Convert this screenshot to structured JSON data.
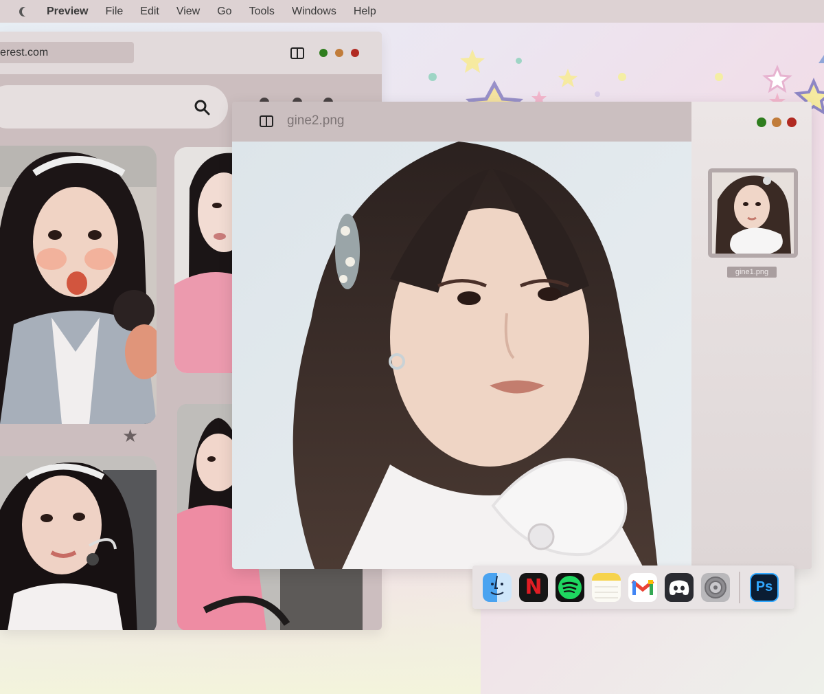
{
  "menubar": {
    "app_name": "Preview",
    "items": [
      "File",
      "Edit",
      "View",
      "Go",
      "Tools",
      "Windows",
      "Help"
    ]
  },
  "browser": {
    "url": "erest.com",
    "traffic_lights": [
      "#2f7d1e",
      "#c17c3a",
      "#b12a22"
    ]
  },
  "preview": {
    "filename": "gine2.png",
    "thumbnail_caption": "gine1.png",
    "traffic_lights": [
      "#2f7d1e",
      "#c17c3a",
      "#b12a22"
    ]
  },
  "dock": {
    "apps": [
      "finder-icon",
      "netflix-icon",
      "spotify-icon",
      "notes-icon",
      "gmail-icon",
      "discord-icon",
      "settings-icon",
      "photoshop-icon"
    ],
    "photoshop_label": "Ps",
    "netflix_label": "N"
  }
}
